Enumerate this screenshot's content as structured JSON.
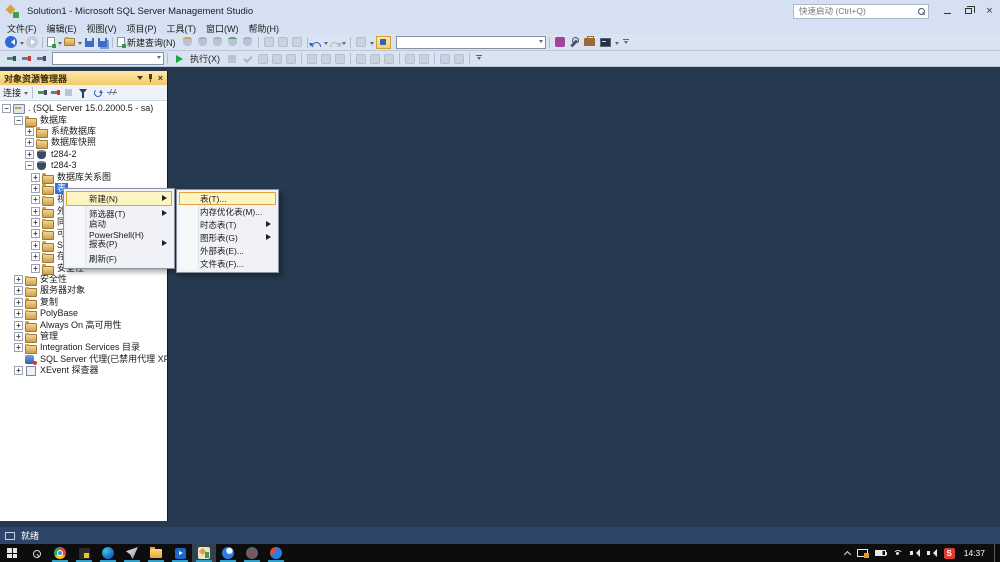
{
  "window": {
    "title": "Solution1 - Microsoft SQL Server Management Studio",
    "quick_launch_placeholder": "快速启动 (Ctrl+Q)"
  },
  "icons": {
    "close_glyph": "×"
  },
  "menubar": {
    "items": [
      "文件(F)",
      "编辑(E)",
      "视图(V)",
      "项目(P)",
      "工具(T)",
      "窗口(W)",
      "帮助(H)"
    ]
  },
  "toolbar": {
    "new_query_label": "新建查询(N)",
    "execute_label": "执行(X)"
  },
  "object_explorer": {
    "title": "对象资源管理器",
    "connect_label": "连接",
    "tree": [
      {
        "label": ". (SQL Server 15.0.2000.5 - sa)",
        "level": 0,
        "expander": "minus",
        "icon": "server"
      },
      {
        "label": "数据库",
        "level": 1,
        "expander": "minus",
        "icon": "folder"
      },
      {
        "label": "系统数据库",
        "level": 2,
        "expander": "plus",
        "icon": "folder"
      },
      {
        "label": "数据库快照",
        "level": 2,
        "expander": "plus",
        "icon": "folder"
      },
      {
        "label": "t284-2",
        "level": 2,
        "expander": "plus",
        "icon": "database"
      },
      {
        "label": "t284-3",
        "level": 2,
        "expander": "minus",
        "icon": "database"
      },
      {
        "label": "数据库关系图",
        "level": 3,
        "expander": "plus",
        "icon": "folder"
      },
      {
        "label": "表",
        "level": 3,
        "expander": "plus",
        "icon": "folder",
        "selected": true
      },
      {
        "label": "视图",
        "level": 3,
        "expander": "plus",
        "icon": "folder"
      },
      {
        "label": "外部资源",
        "level": 3,
        "expander": "plus",
        "icon": "folder"
      },
      {
        "label": "同义词",
        "level": 3,
        "expander": "plus",
        "icon": "folder"
      },
      {
        "label": "可编程性",
        "level": 3,
        "expander": "plus",
        "icon": "folder"
      },
      {
        "label": "Service Broker",
        "level": 3,
        "expander": "plus",
        "icon": "folder"
      },
      {
        "label": "存储",
        "level": 3,
        "expander": "plus",
        "icon": "folder"
      },
      {
        "label": "安全性",
        "level": 3,
        "expander": "plus",
        "icon": "folder"
      },
      {
        "label": "安全性",
        "level": 1,
        "expander": "plus",
        "icon": "folder"
      },
      {
        "label": "服务器对象",
        "level": 1,
        "expander": "plus",
        "icon": "folder"
      },
      {
        "label": "复制",
        "level": 1,
        "expander": "plus",
        "icon": "folder"
      },
      {
        "label": "PolyBase",
        "level": 1,
        "expander": "plus",
        "icon": "folder"
      },
      {
        "label": "Always On 高可用性",
        "level": 1,
        "expander": "plus",
        "icon": "folder"
      },
      {
        "label": "管理",
        "level": 1,
        "expander": "plus",
        "icon": "folder"
      },
      {
        "label": "Integration Services 目录",
        "level": 1,
        "expander": "plus",
        "icon": "folder"
      },
      {
        "label": "SQL Server 代理(已禁用代理 XP)",
        "level": 1,
        "expander": "none",
        "icon": "agent"
      },
      {
        "label": "XEvent 探查器",
        "level": 1,
        "expander": "plus",
        "icon": "xevent"
      }
    ]
  },
  "context_menu": {
    "items": [
      {
        "label": "新建(N)",
        "arrow": true,
        "highlighted": true
      },
      {
        "label": "筛选器(T)",
        "arrow": true
      },
      {
        "label": "启动 PowerShell(H)"
      },
      {
        "label": "报表(P)",
        "arrow": true
      },
      {
        "label": "刷新(F)"
      }
    ]
  },
  "submenu": {
    "items": [
      {
        "label": "表(T)...",
        "highlighted": true
      },
      {
        "label": "内存优化表(M)..."
      },
      {
        "label": "时态表(T)",
        "arrow": true
      },
      {
        "label": "图形表(G)",
        "arrow": true
      },
      {
        "label": "外部表(E)..."
      },
      {
        "label": "文件表(F)..."
      }
    ]
  },
  "statusbar": {
    "ready": "就绪"
  },
  "taskbar": {
    "time": "14:37",
    "tray_input_letter": "S",
    "apps": [
      {
        "name": "chrome"
      },
      {
        "name": "code-editor"
      },
      {
        "name": "edge"
      },
      {
        "name": "mail"
      },
      {
        "name": "file-explorer"
      },
      {
        "name": "movies-tv"
      },
      {
        "name": "ssms",
        "active": true
      },
      {
        "name": "browser"
      },
      {
        "name": "recorder"
      },
      {
        "name": "downloader"
      }
    ]
  }
}
